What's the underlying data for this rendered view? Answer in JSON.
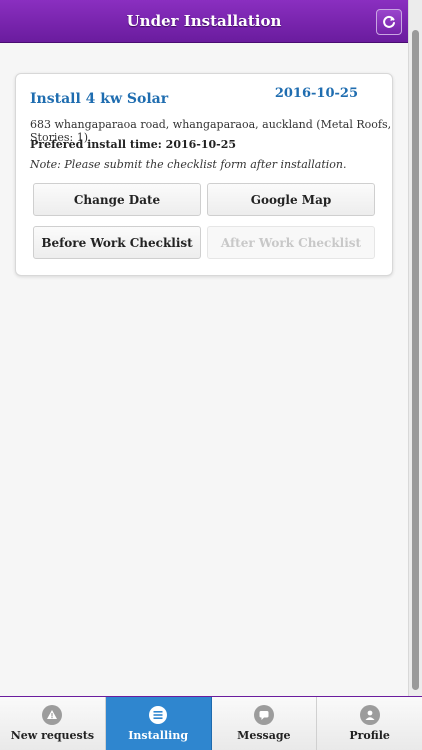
{
  "header": {
    "title": "Under Installation",
    "refresh_icon": "refresh-icon"
  },
  "job": {
    "title": "Install 4 kw Solar",
    "date": "2016-10-25",
    "address": "683 whangaparaoa road, whangaparaoa, auckland (Metal Roofs, Stories: 1)",
    "install_time": "Prefered install time: 2016-10-25",
    "note": "Note: Please submit the checklist form after installation.",
    "buttons": {
      "change_date": "Change Date",
      "google_map": "Google Map",
      "before_checklist": "Before Work Checklist",
      "after_checklist": "After Work Checklist"
    }
  },
  "tabbar": {
    "tabs": [
      {
        "label": "New requests",
        "icon": "alert-icon",
        "active": false
      },
      {
        "label": "Installing",
        "icon": "menu-icon",
        "active": true
      },
      {
        "label": "Message",
        "icon": "chat-icon",
        "active": false
      },
      {
        "label": "Profile",
        "icon": "user-icon",
        "active": false
      }
    ]
  },
  "colors": {
    "header_purple": "#6a1c9e",
    "link_blue": "#1f6db0",
    "active_tab_blue": "#2f86cf"
  }
}
